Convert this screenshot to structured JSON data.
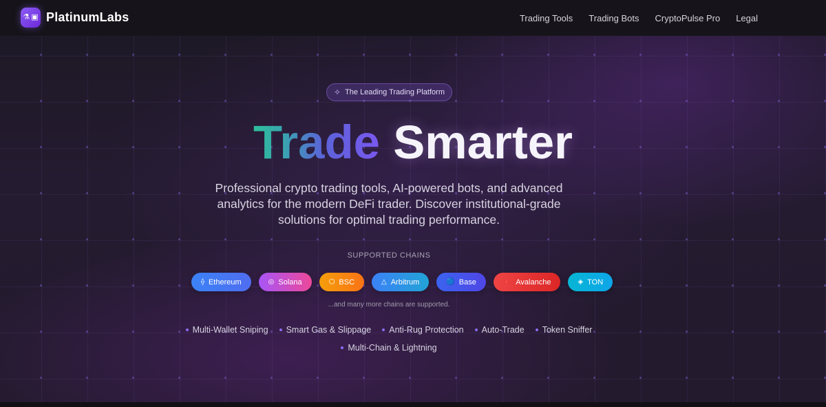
{
  "nav": {
    "brand": "PlatinumLabs",
    "logo_icons": [
      "flask-icon",
      "chip-icon"
    ],
    "links": [
      {
        "label": "Trading Tools"
      },
      {
        "label": "Trading Bots"
      },
      {
        "label": "CryptoPulse Pro"
      },
      {
        "label": "Legal"
      }
    ]
  },
  "hero": {
    "badge": "The Leading Trading Platform",
    "badge_icon": "sparkles-icon",
    "headline_accent": "Trade",
    "headline_main": "Smarter",
    "subtitle": "Professional crypto trading tools, AI-powered bots, and advanced analytics for the modern DeFi trader. Discover institutional-grade solutions for optimal trading performance.",
    "chains_label": "SUPPORTED CHAINS",
    "chains_note": "...and many more chains are supported."
  },
  "chains": [
    {
      "label": "Ethereum",
      "icon": "⟠",
      "icon_name": "ethereum-icon",
      "colors": [
        "#3b82f6",
        "#4f6df0"
      ]
    },
    {
      "label": "Solana",
      "icon": "◎",
      "icon_name": "solana-icon",
      "colors": [
        "#a855f7",
        "#ec4899"
      ]
    },
    {
      "label": "BSC",
      "icon": "⬡",
      "icon_name": "bsc-icon",
      "colors": [
        "#f59e0b",
        "#f97316"
      ]
    },
    {
      "label": "Arbitrum",
      "icon": "△",
      "icon_name": "arbitrum-icon",
      "colors": [
        "#3b82f6",
        "#22a3d6"
      ]
    },
    {
      "label": "Base",
      "icon": "🔵",
      "icon_name": "base-icon",
      "colors": [
        "#3b63f0",
        "#4f46e5"
      ]
    },
    {
      "label": "Avalanche",
      "icon": "🔺",
      "icon_name": "avalanche-icon",
      "colors": [
        "#ef4444",
        "#dc2626"
      ]
    },
    {
      "label": "TON",
      "icon": "◈",
      "icon_name": "ton-icon",
      "colors": [
        "#06b6d4",
        "#0ea5e9"
      ]
    }
  ],
  "features": [
    {
      "label": "Multi-Wallet Sniping"
    },
    {
      "label": "Smart Gas & Slippage"
    },
    {
      "label": "Anti-Rug Protection"
    },
    {
      "label": "Auto-Trade"
    },
    {
      "label": "Token Sniffer"
    },
    {
      "label": "Multi-Chain & Lightning"
    }
  ]
}
